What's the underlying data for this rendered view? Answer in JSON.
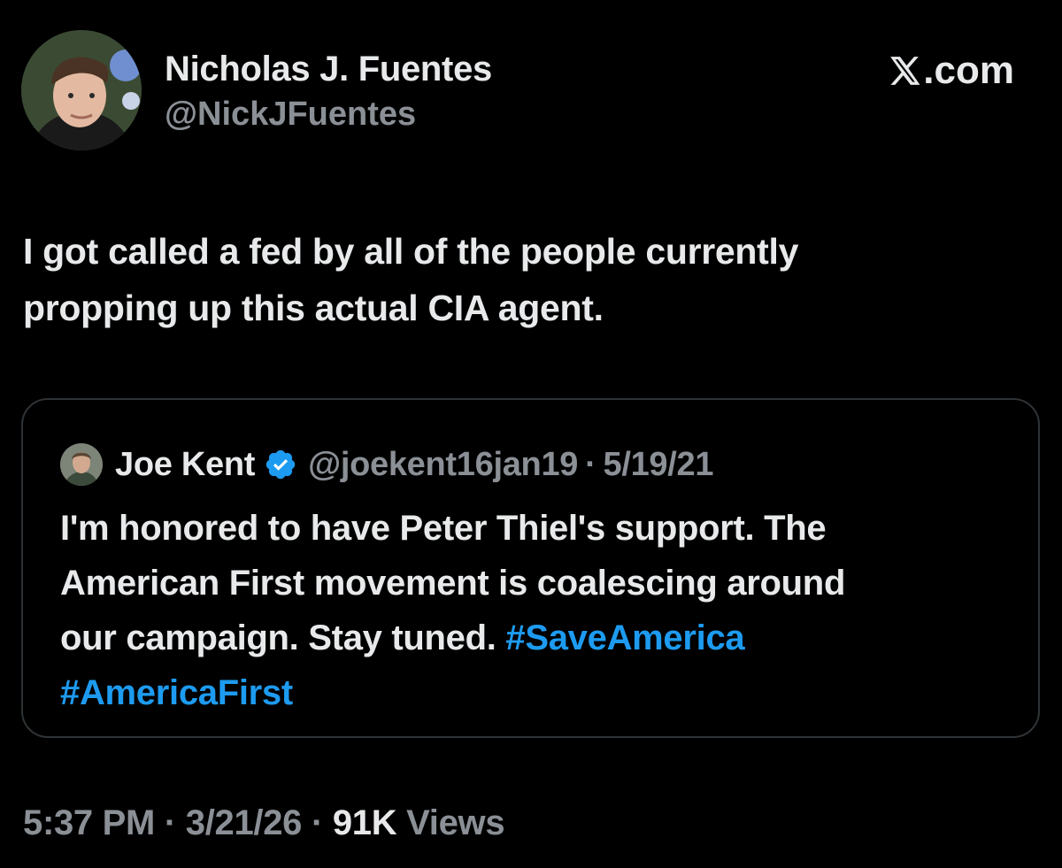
{
  "author": {
    "name": "Nicholas J. Fuentes",
    "handle": "@NickJFuentes",
    "avatar_icon": "profile-photo"
  },
  "brand": {
    "label": ".com",
    "icon": "x-logo-icon"
  },
  "tweet": {
    "text_line1": "I got called a fed by all of the people currently",
    "text_line2": "propping up this actual CIA agent."
  },
  "quote": {
    "name": "Joe Kent",
    "verified_icon": "verified-badge-icon",
    "handle": "@joekent16jan19",
    "separator": "·",
    "date": "5/19/21",
    "text_line1": "I'm honored to have Peter Thiel's support. The",
    "text_line2": "American First movement is coalescing around",
    "text_line3_plain": "our campaign. Stay tuned. ",
    "hashtag1": "#SaveAmerica",
    "hashtag2": "#AmericaFirst"
  },
  "meta": {
    "time": "5:37 PM",
    "separator": "·",
    "date": "3/21/26",
    "views_count": "91K",
    "views_label": "Views"
  },
  "colors": {
    "background": "#000000",
    "primary_text": "#e7e9ea",
    "secondary_text": "#8b9096",
    "hashtag": "#1d9bf0",
    "border": "#2f3336"
  }
}
